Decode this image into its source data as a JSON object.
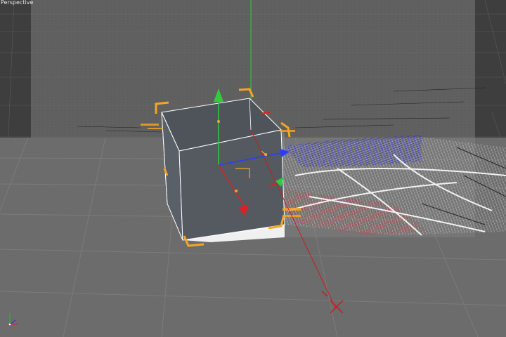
{
  "viewport": {
    "label": "Perspective",
    "colors": {
      "background": "#444444",
      "floor": "#686868",
      "overlay": "#8a8a8a",
      "cube_face": "#50555c",
      "selection": "#f5a623",
      "axis_x": "#e02020",
      "axis_y": "#20c020",
      "axis_z": "#2020e0"
    }
  },
  "objects": {
    "cube": "cube-object",
    "gizmo": "move-tool-gizmo",
    "wire_cloth": "wireframe-cloth-object",
    "world_axis": "world-axis-icon"
  }
}
